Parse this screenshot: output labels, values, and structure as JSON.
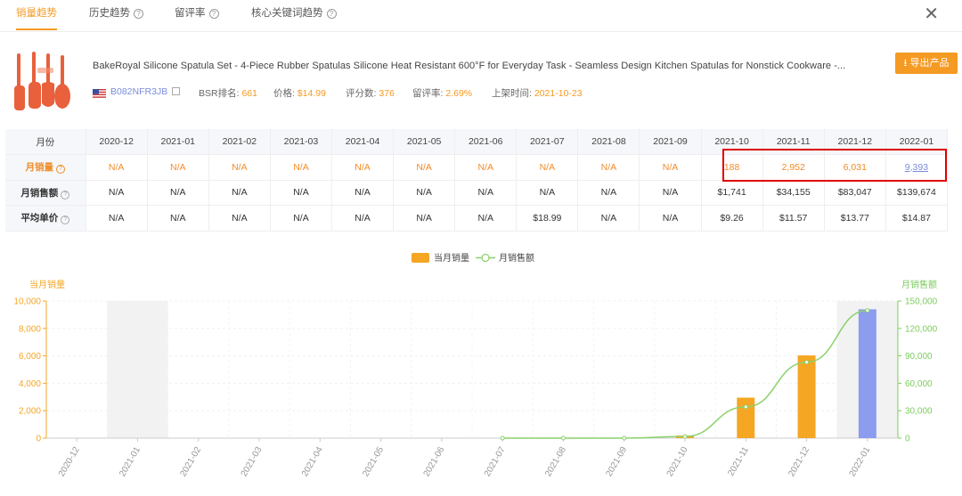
{
  "tabs": [
    {
      "label": "销量趋势",
      "active": true,
      "help": false
    },
    {
      "label": "历史趋势",
      "active": false,
      "help": true
    },
    {
      "label": "留评率",
      "active": false,
      "help": true
    },
    {
      "label": "核心关键词趋势",
      "active": false,
      "help": true
    }
  ],
  "close_label": "✕",
  "product": {
    "title": "BakeRoyal Silicone Spatula Set - 4-Piece Rubber Spatulas Silicone Heat Resistant 600°F for Everyday Task - Seamless Design Kitchen Spatulas for Nonstick Cookware -...",
    "asin": "B082NFR3JB",
    "bsr_label": "BSR排名:",
    "bsr_value": "661",
    "price_label": "价格:",
    "price_value": "$14.99",
    "rating_label": "评分数:",
    "rating_value": "376",
    "review_rate_label": "留评率:",
    "review_rate_value": "2.69%",
    "launch_label": "上架时间:",
    "launch_value": "2021-10-23"
  },
  "export_label": "导出产品",
  "table": {
    "month_header": "月份",
    "months": [
      "2020-12",
      "2021-01",
      "2021-02",
      "2021-03",
      "2021-04",
      "2021-05",
      "2021-06",
      "2021-07",
      "2021-08",
      "2021-09",
      "2021-10",
      "2021-11",
      "2021-12",
      "2022-01"
    ],
    "rows": [
      {
        "label": "月销量",
        "values": [
          "N/A",
          "N/A",
          "N/A",
          "N/A",
          "N/A",
          "N/A",
          "N/A",
          "N/A",
          "N/A",
          "N/A",
          "188",
          "2,952",
          "6,031",
          "9,393"
        ]
      },
      {
        "label": "月销售额",
        "values": [
          "N/A",
          "N/A",
          "N/A",
          "N/A",
          "N/A",
          "N/A",
          "N/A",
          "N/A",
          "N/A",
          "N/A",
          "$1,741",
          "$34,155",
          "$83,047",
          "$139,674"
        ]
      },
      {
        "label": "平均单价",
        "values": [
          "N/A",
          "N/A",
          "N/A",
          "N/A",
          "N/A",
          "N/A",
          "N/A",
          "$18.99",
          "N/A",
          "N/A",
          "$9.26",
          "$11.57",
          "$13.77",
          "$14.87"
        ]
      }
    ]
  },
  "chart_data": {
    "type": "bar",
    "categories": [
      "2020-12",
      "2021-01",
      "2021-02",
      "2021-03",
      "2021-04",
      "2021-05",
      "2021-06",
      "2021-07",
      "2021-08",
      "2021-09",
      "2021-10",
      "2021-11",
      "2021-12",
      "2022-01"
    ],
    "series": [
      {
        "name": "当月销量",
        "type": "bar",
        "axis": "left",
        "values": [
          0,
          0,
          0,
          0,
          0,
          0,
          0,
          0,
          0,
          0,
          188,
          2952,
          6031,
          9393
        ]
      },
      {
        "name": "月销售额",
        "type": "line",
        "axis": "right",
        "values": [
          null,
          null,
          null,
          null,
          null,
          null,
          null,
          0,
          0,
          0,
          1741,
          34155,
          83047,
          139674
        ]
      }
    ],
    "ylabel_left": "当月销量",
    "ylabel_right": "月销售额",
    "ylim_left": [
      0,
      10000
    ],
    "ylim_right": [
      0,
      150000
    ],
    "yticks_left": [
      "0",
      "2,000",
      "4,000",
      "6,000",
      "8,000",
      "10,000"
    ],
    "yticks_right": [
      "0",
      "30,000",
      "60,000",
      "90,000",
      "120,000",
      "150,000"
    ],
    "legend_position": "top-center",
    "shaded_categories": [
      "2021-01",
      "2022-01"
    ],
    "highlighted_bar": "2022-01",
    "colors": {
      "bar": "#f5a623",
      "bar_highlight": "#8c9cef",
      "line": "#8bd16a",
      "axis_left": "#f5a623",
      "axis_right": "#7ccc5c",
      "shade": "#f2f2f2"
    }
  }
}
